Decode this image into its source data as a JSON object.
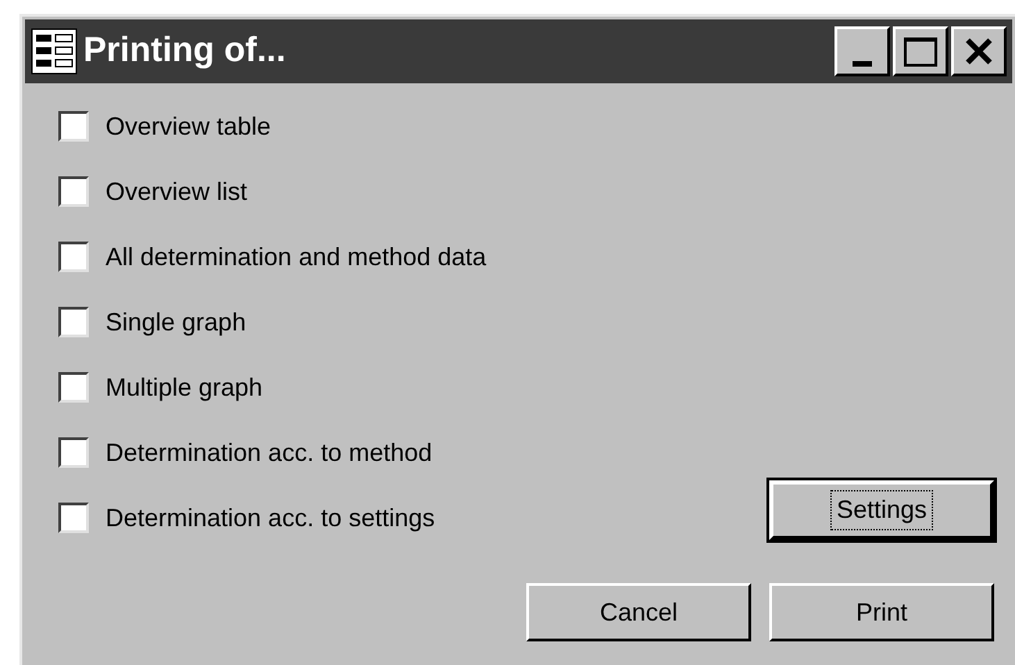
{
  "window": {
    "title": "Printing of..."
  },
  "options": [
    {
      "label": "Overview table",
      "checked": false
    },
    {
      "label": "Overview list",
      "checked": false
    },
    {
      "label": "All determination and method data",
      "checked": false
    },
    {
      "label": "Single graph",
      "checked": false
    },
    {
      "label": "Multiple graph",
      "checked": false
    },
    {
      "label": "Determination acc. to method",
      "checked": false
    },
    {
      "label": "Determination acc. to settings",
      "checked": false
    }
  ],
  "settings_button": {
    "label": "Settings",
    "focused": true
  },
  "buttons": [
    {
      "label": "Cancel",
      "focused": false
    },
    {
      "label": "Print",
      "focused": false
    }
  ]
}
